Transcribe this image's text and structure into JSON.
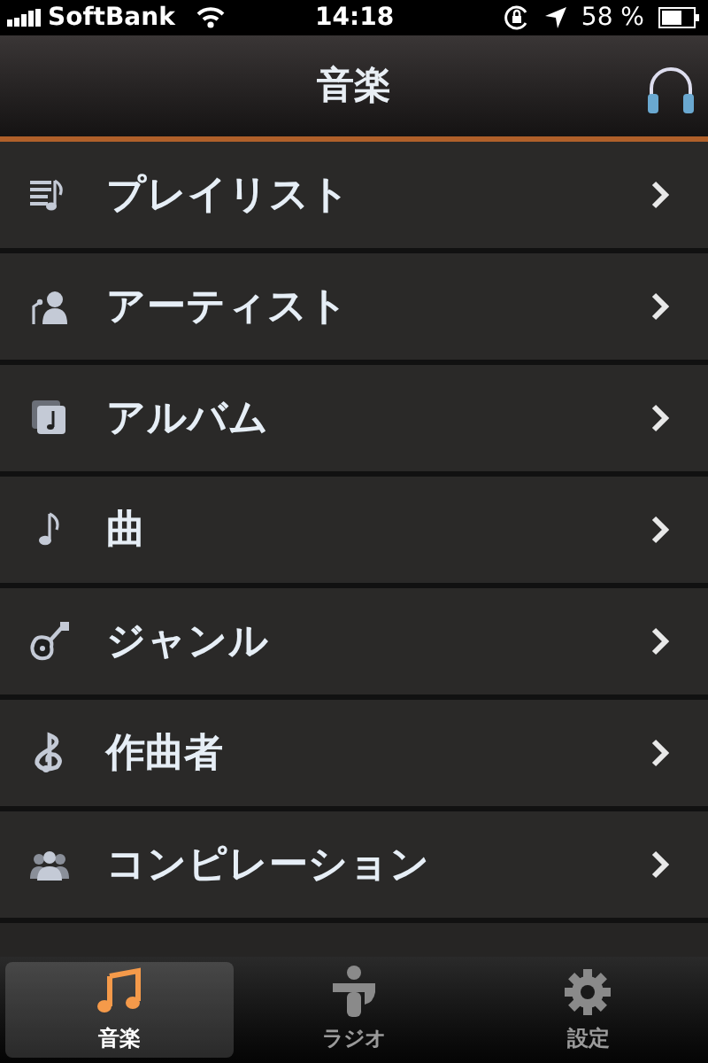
{
  "status_bar": {
    "carrier": "SoftBank",
    "time": "14:18",
    "battery": "58 %"
  },
  "nav_bar": {
    "title": "音楽"
  },
  "list": [
    {
      "label": "プレイリスト",
      "kind": "playlist"
    },
    {
      "label": "アーティスト",
      "kind": "artist"
    },
    {
      "label": "アルバム",
      "kind": "album"
    },
    {
      "label": "曲",
      "kind": "song"
    },
    {
      "label": "ジャンル",
      "kind": "genre"
    },
    {
      "label": "作曲者",
      "kind": "composer"
    },
    {
      "label": "コンピレーション",
      "kind": "compilation"
    }
  ],
  "tab_bar": [
    {
      "label": "音楽",
      "kind": "music",
      "selected": true
    },
    {
      "label": "ラジオ",
      "kind": "radio",
      "selected": false
    },
    {
      "label": "設定",
      "kind": "settings",
      "selected": false
    }
  ]
}
